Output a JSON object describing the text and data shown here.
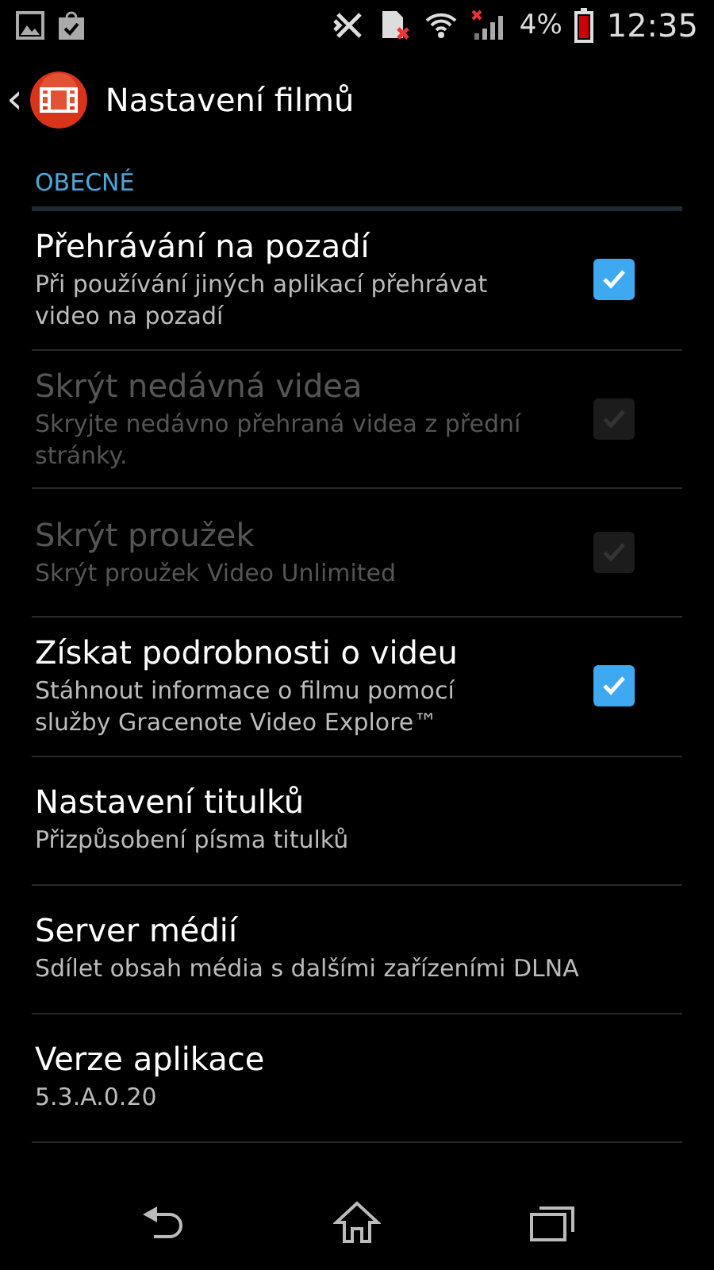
{
  "status_bar": {
    "battery_text": "4%",
    "time": "12:35"
  },
  "action_bar": {
    "back": "‹",
    "title": "Nastavení filmů"
  },
  "section": {
    "title": "OBECNÉ"
  },
  "items": [
    {
      "kind": "checkbox",
      "title": "Přehrávání na pozadí",
      "summary": "Při používání jiných aplikací přehrávat video na pozadí",
      "checked": true,
      "disabled": false
    },
    {
      "kind": "checkbox",
      "title": "Skrýt nedávná videa",
      "summary": "Skryjte nedávno přehraná videa z přední stránky.",
      "checked": true,
      "disabled": true
    },
    {
      "kind": "checkbox",
      "title": "Skrýt proužek",
      "summary": "Skrýt proužek Video Unlimited",
      "checked": true,
      "disabled": true
    },
    {
      "kind": "checkbox",
      "title": "Získat podrobnosti o videu",
      "summary": "Stáhnout informace o filmu pomocí služby Gracenote Video Explore™",
      "checked": true,
      "disabled": false
    },
    {
      "kind": "plain",
      "title": "Nastavení titulků",
      "summary": "Přizpůsobení písma titulků",
      "disabled": false
    },
    {
      "kind": "plain",
      "title": "Server médií",
      "summary": "Sdílet obsah média s dalšími zařízeními DLNA",
      "disabled": false
    },
    {
      "kind": "plain",
      "title": "Verze aplikace",
      "summary": "5.3.A.0.20",
      "disabled": false
    }
  ]
}
